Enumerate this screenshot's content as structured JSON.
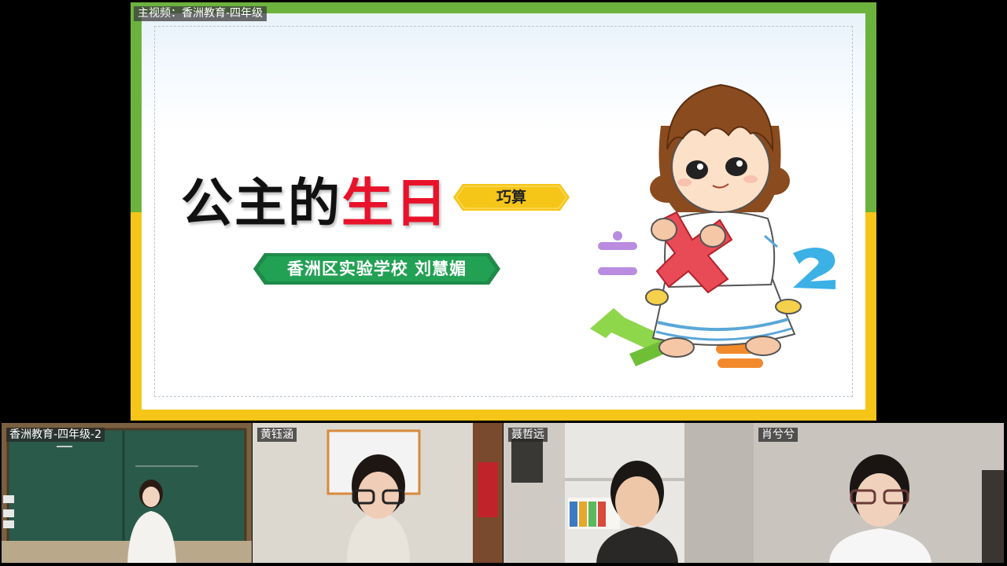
{
  "main_video": {
    "label": "主视频：香洲教育-四年级",
    "slide": {
      "title_black": "公主的",
      "title_red": "生日",
      "tag": "巧算",
      "ribbon": "香洲区实验学校    刘慧媚"
    }
  },
  "participants": [
    {
      "name": "香洲教育-四年级-2"
    },
    {
      "name": "黄钰涵"
    },
    {
      "name": "聂哲远"
    },
    {
      "name": "肖兮兮"
    }
  ],
  "colors": {
    "frame_green": "#6cb33e",
    "frame_yellow": "#f5c518",
    "title_red": "#e8122a",
    "ribbon_green": "#1f8a4a",
    "tag_yellow": "#f5c518"
  }
}
